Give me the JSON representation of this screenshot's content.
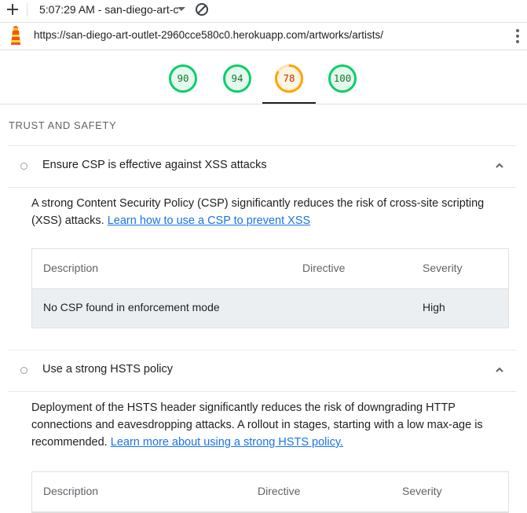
{
  "toolbar": {
    "session_label": "5:07:29 AM - san-diego-art-c",
    "url": "https://san-diego-art-outlet-2960cce580c0.herokuapp.com/artworks/artists/"
  },
  "scores": [
    {
      "value": "90",
      "status": "pass",
      "color": "#0cce6b"
    },
    {
      "value": "94",
      "status": "pass",
      "color": "#0cce6b"
    },
    {
      "value": "78",
      "status": "average",
      "color": "#ffa400"
    },
    {
      "value": "100",
      "status": "pass",
      "color": "#0cce6b"
    }
  ],
  "section": {
    "title": "TRUST AND SAFETY"
  },
  "audits": [
    {
      "title": "Ensure CSP is effective against XSS attacks",
      "description": "A strong Content Security Policy (CSP) significantly reduces the risk of cross-site scripting (XSS) attacks.",
      "link": "Learn how to use a CSP to prevent XSS",
      "columns": [
        "Description",
        "Directive",
        "Severity"
      ],
      "rows": [
        {
          "description": "No CSP found in enforcement mode",
          "directive": "",
          "severity": "High"
        }
      ]
    },
    {
      "title": "Use a strong HSTS policy",
      "description": "Deployment of the HSTS header significantly reduces the risk of downgrading HTTP connections and eavesdropping attacks. A rollout in stages, starting with a low max-age is recommended.",
      "link": "Learn more about using a strong HSTS policy.",
      "columns": [
        "Description",
        "Directive",
        "Severity"
      ]
    }
  ]
}
